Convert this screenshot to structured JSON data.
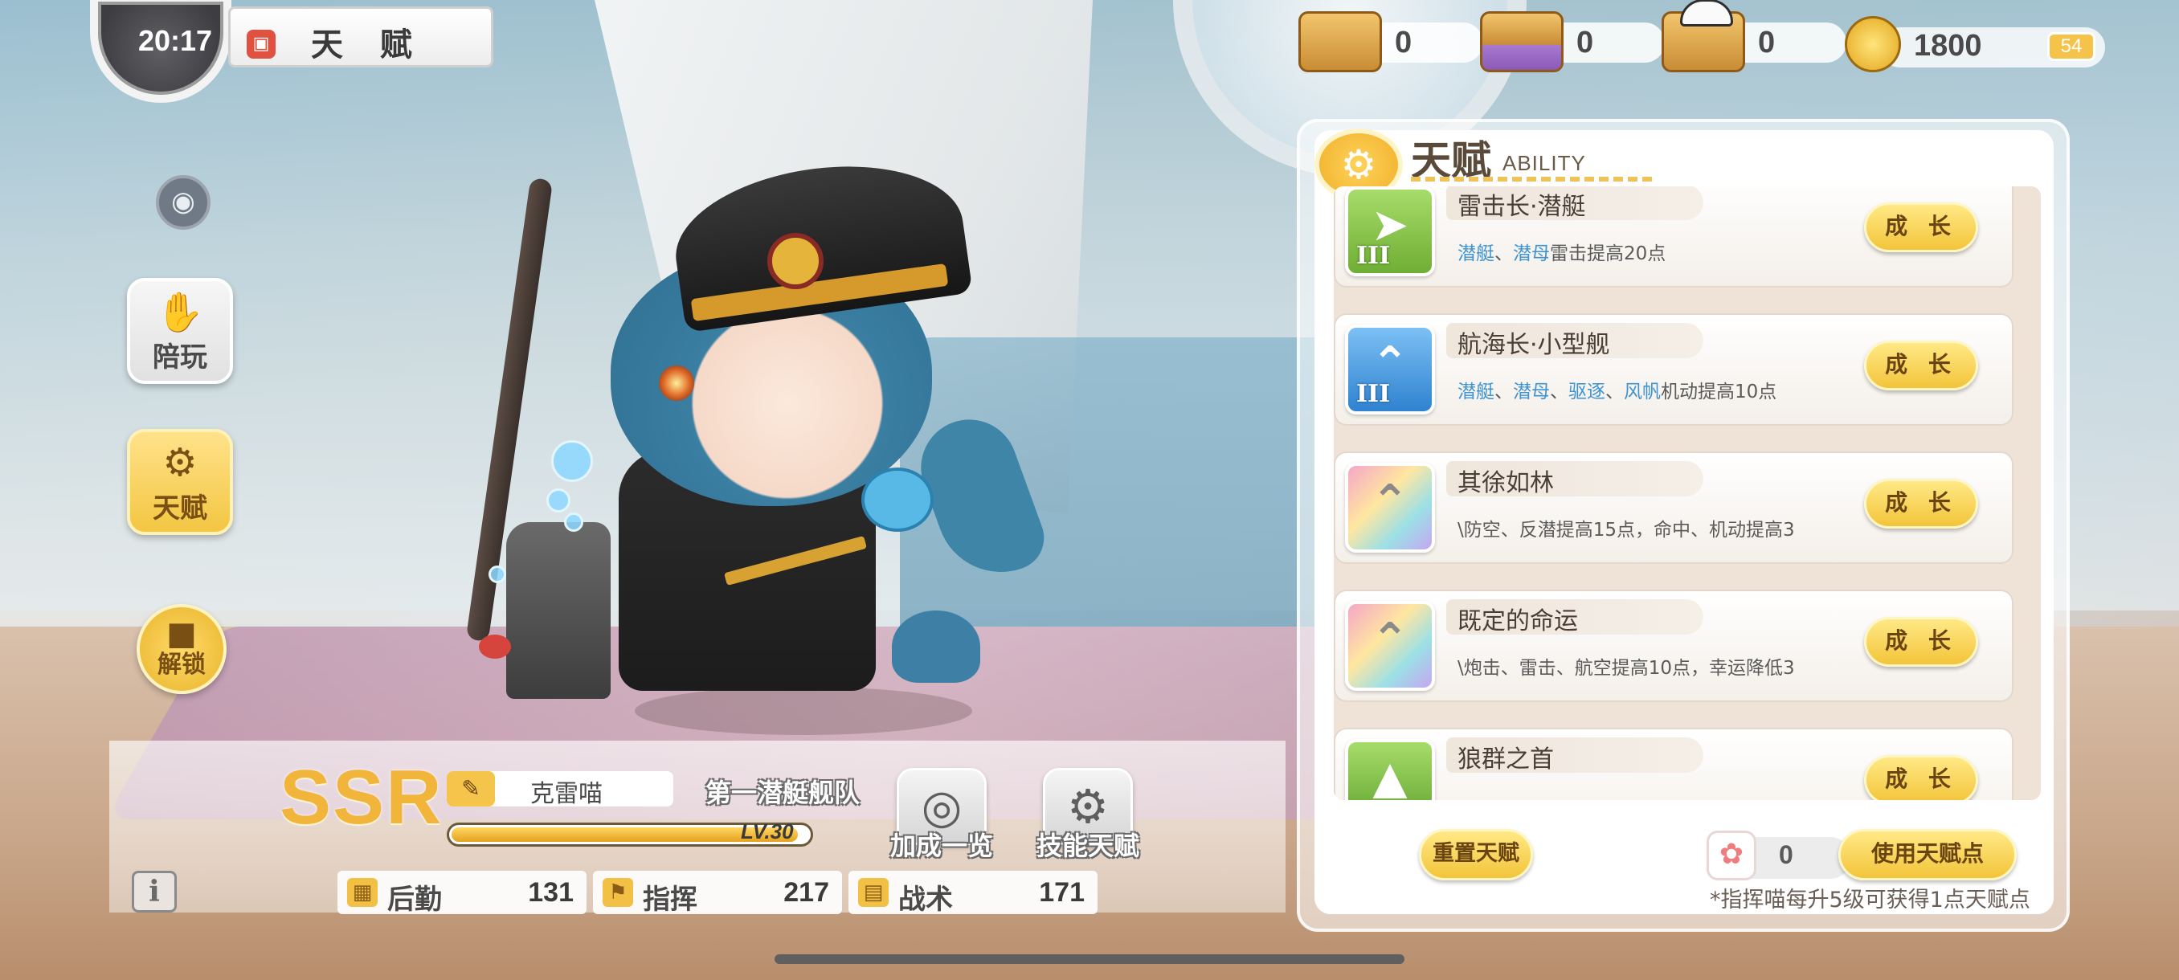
{
  "status": {
    "clock": "20:17",
    "battery": "54"
  },
  "header": {
    "title": "天 赋"
  },
  "resources": [
    {
      "icon": "cardboard-box-icon",
      "value": "0"
    },
    {
      "icon": "purple-box-icon",
      "value": "0"
    },
    {
      "icon": "captain-box-icon",
      "value": "0"
    }
  ],
  "coins": {
    "icon": "gold-coin-icon",
    "value": "1800"
  },
  "side_menu": {
    "play_label": "陪玩",
    "talent_label": "天赋",
    "unlock_label": "解锁"
  },
  "panel": {
    "title": "天赋",
    "subtitle": "ABILITY",
    "grow_label": "成 长",
    "reset_label": "重置天赋",
    "points_value": "0",
    "use_points_label": "使用天赋点",
    "note": "*指挥喵每升5级可获得1点天赋点",
    "talents": [
      {
        "name": "雷击长·潜艇",
        "tier": "III",
        "ships": [
          "潜艇",
          "潜母"
        ],
        "desc_rest": "雷击提高20点",
        "color": "#8cc84b"
      },
      {
        "name": "航海长·小型舰",
        "tier": "III",
        "ships": [
          "潜艇",
          "潜母",
          "驱逐",
          "风帆"
        ],
        "desc_rest": "机动提高10点",
        "color": "#4a9be0"
      },
      {
        "name": "其徐如林",
        "tier": "",
        "ships": [],
        "desc_rest": "\\防空、反潜提高15点，命中、机动提高3点",
        "color": "#e9a0c0"
      },
      {
        "name": "既定的命运",
        "tier": "",
        "ships": [],
        "desc_rest": "\\炮击、雷击、航空提高10点，幸运降低3点",
        "color": "#e9a0c0"
      },
      {
        "name": "狼群之首",
        "tier": "",
        "ships": [],
        "desc_rest": "",
        "color": "#7cc24a"
      }
    ]
  },
  "character": {
    "rarity": "SSR",
    "name": "克雷喵",
    "fleet": "第一潜艇舰队",
    "level": "LV.30",
    "level_progress": 0.97,
    "bonus_label": "加成一览",
    "skill_label": "技能天赋"
  },
  "stats": [
    {
      "label": "后勤",
      "value": "131",
      "icon": "box-icon"
    },
    {
      "label": "指挥",
      "value": "217",
      "icon": "flag-icon"
    },
    {
      "label": "战术",
      "value": "171",
      "icon": "book-icon"
    }
  ]
}
